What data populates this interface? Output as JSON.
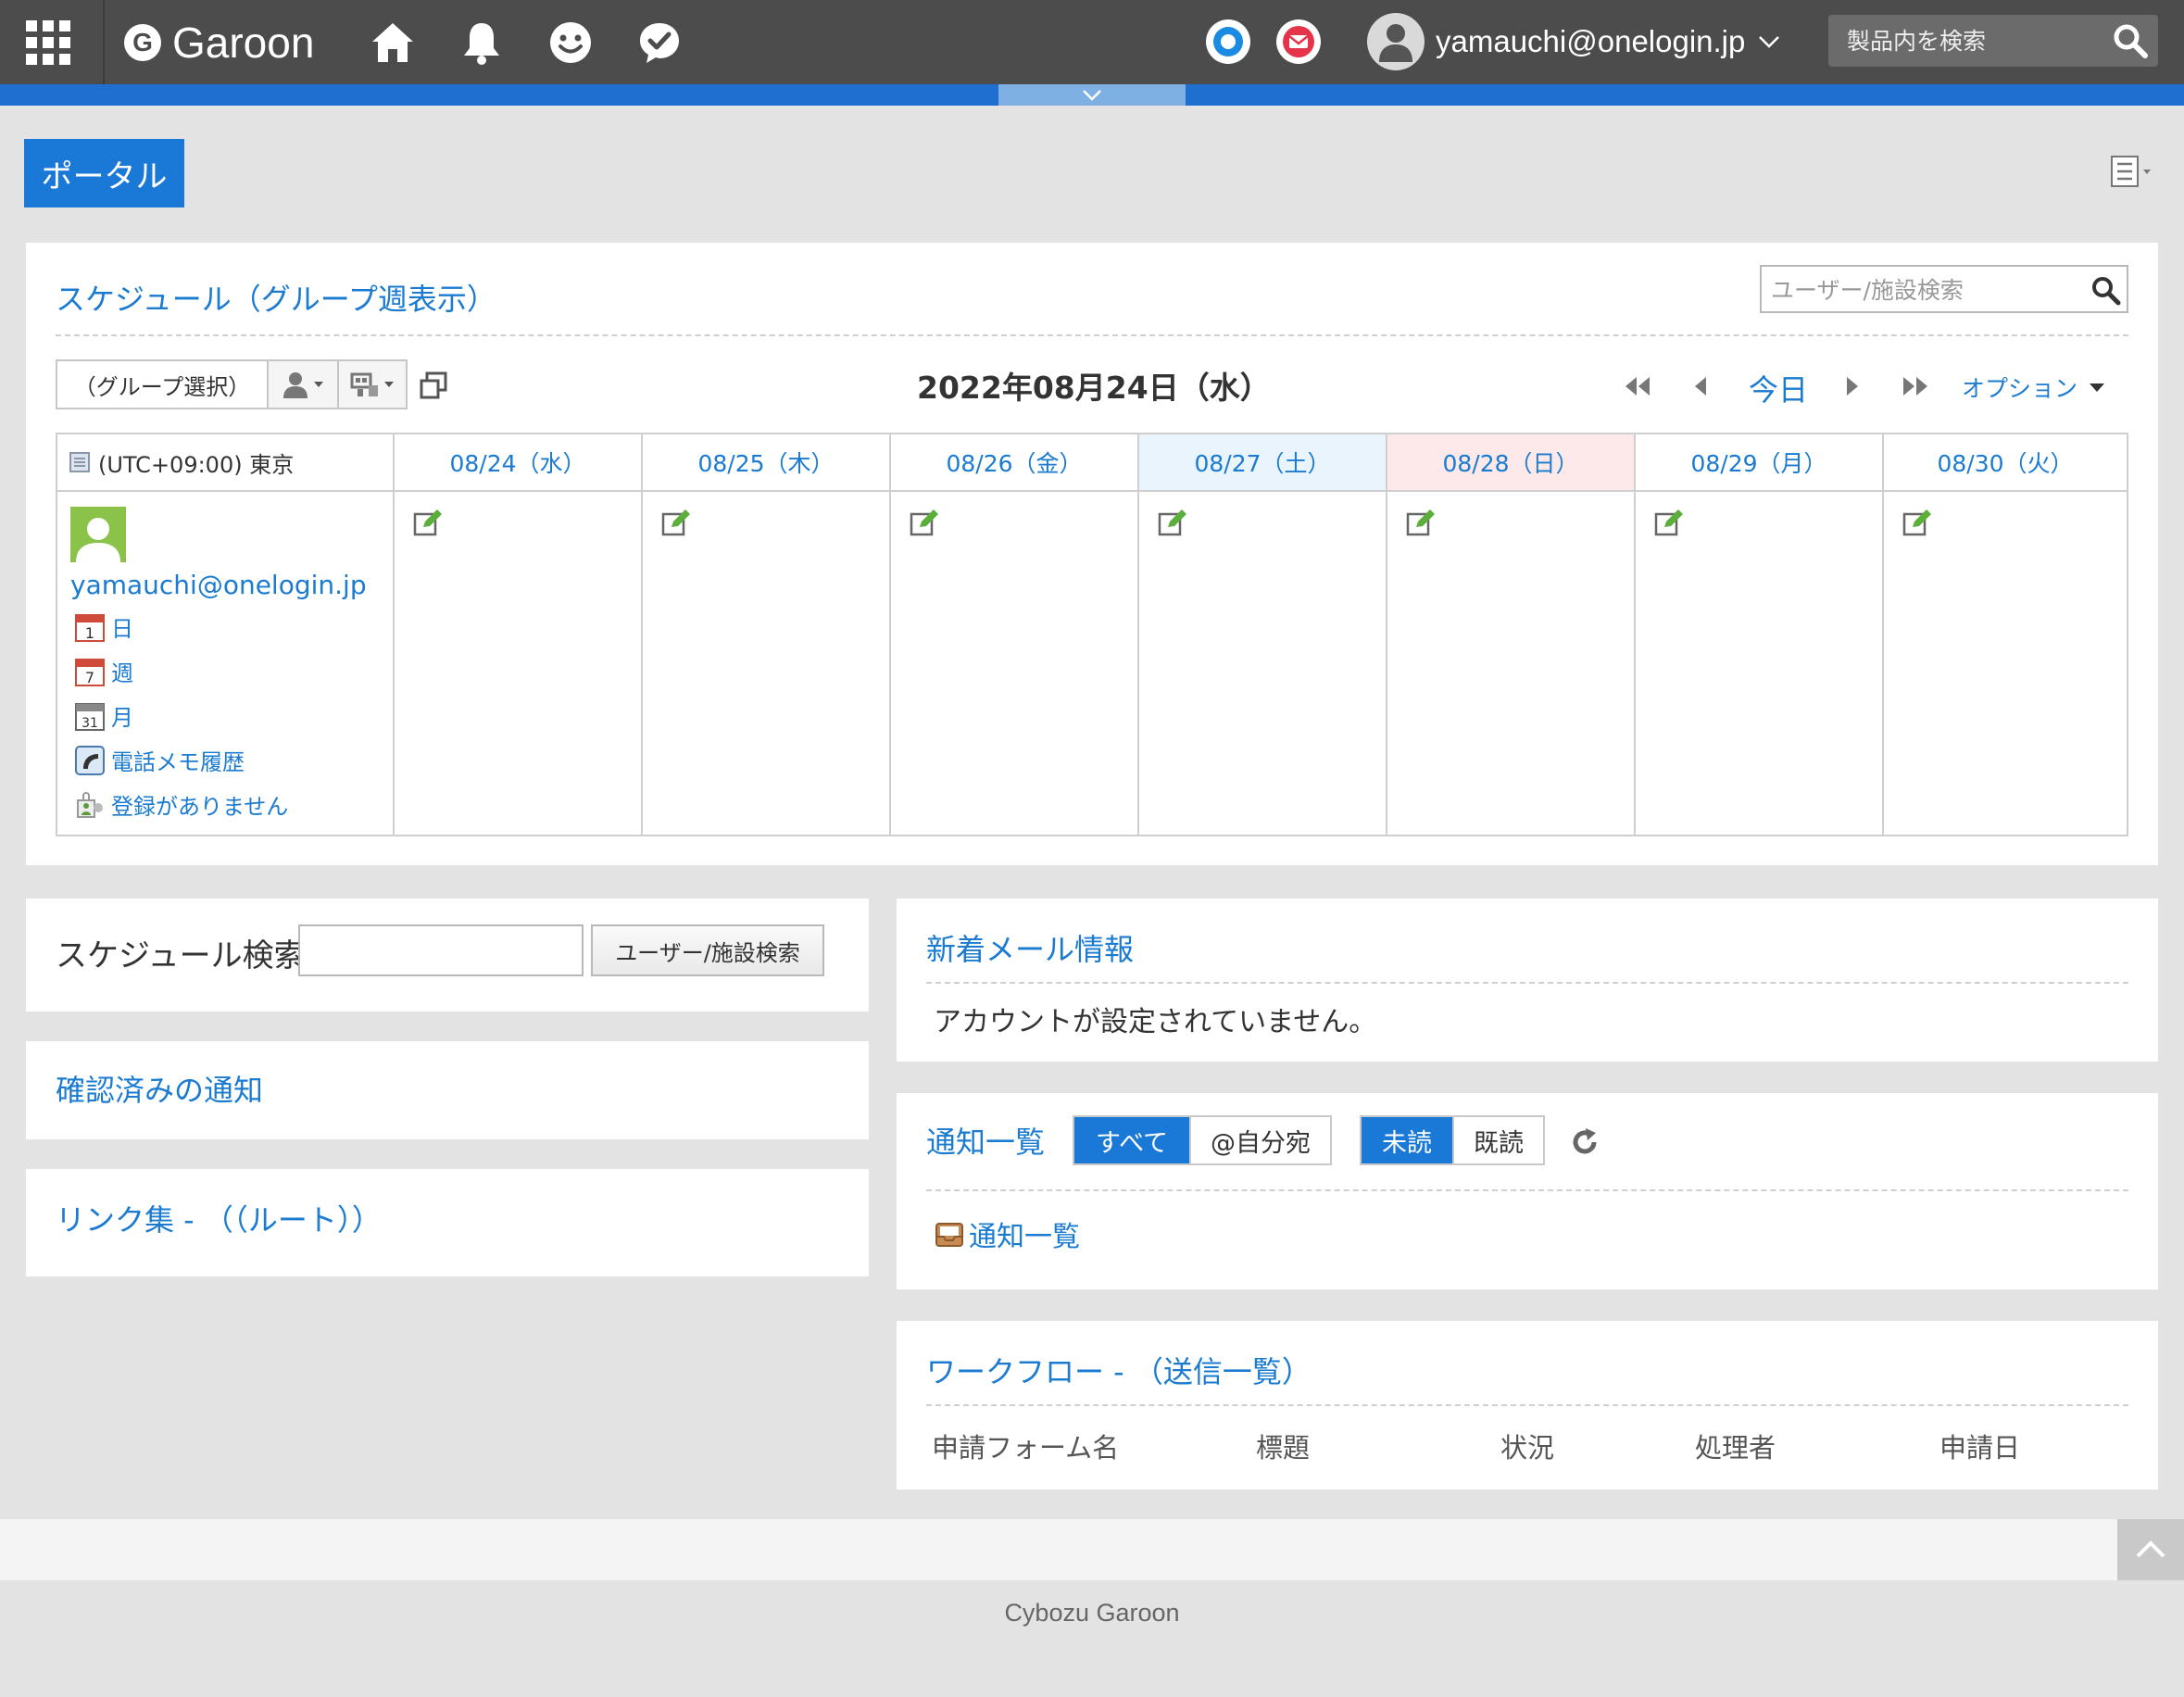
{
  "header": {
    "logo_letter": "G",
    "logo_text": "Garoon",
    "user_name": "yamauchi@onelogin.jp",
    "search_placeholder": "製品内を検索"
  },
  "portal": {
    "tab_label": "ポータル"
  },
  "schedule": {
    "title": "スケジュール（グループ週表示）",
    "search_placeholder": "ユーザー/施設検索",
    "group_select_label": "（グループ選択）",
    "date_title": "2022年08月24日（水）",
    "today_label": "今日",
    "option_label": "オプション",
    "timezone_label": "(UTC+09:00) 東京",
    "days": [
      {
        "label": "08/24（水）",
        "kind": "weekday"
      },
      {
        "label": "08/25（木）",
        "kind": "weekday"
      },
      {
        "label": "08/26（金）",
        "kind": "weekday"
      },
      {
        "label": "08/27（土）",
        "kind": "sat"
      },
      {
        "label": "08/28（日）",
        "kind": "sun"
      },
      {
        "label": "08/29（月）",
        "kind": "weekday"
      },
      {
        "label": "08/30（火）",
        "kind": "weekday"
      }
    ],
    "user": {
      "name": "yamauchi@onelogin.jp",
      "links": {
        "day": "日",
        "week": "週",
        "month": "月",
        "phone_memo": "電話メモ履歴",
        "no_registration": "登録がありません"
      },
      "icon_numbers": {
        "day": "1",
        "week": "7",
        "month": "31"
      }
    }
  },
  "schedule_search": {
    "label": "スケジュール検索",
    "input_value": "",
    "button_label": "ユーザー/施設検索"
  },
  "confirmed_notifications": {
    "title": "確認済みの通知"
  },
  "links_panel": {
    "title": "リンク集 - （（ルート））"
  },
  "new_mail": {
    "title": "新着メール情報",
    "message": "アカウントが設定されていません。"
  },
  "notifications": {
    "title": "通知一覧",
    "filter_all": "すべて",
    "filter_mine": "@自分宛",
    "filter_unread": "未読",
    "filter_read": "既読",
    "list_link": "通知一覧"
  },
  "workflow": {
    "title": "ワークフロー - （送信一覧）",
    "columns": [
      "申請フォーム名",
      "標題",
      "状況",
      "処理者",
      "申請日"
    ]
  },
  "footer": {
    "text": "Cybozu Garoon"
  },
  "colors": {
    "accent": "#1a78d6",
    "link": "#1a7bd1",
    "header_bg": "#4c4c4c",
    "page_bg": "#e3e3e3",
    "saturday_bg": "#eaf4fc",
    "sunday_bg": "#fde9e9"
  }
}
